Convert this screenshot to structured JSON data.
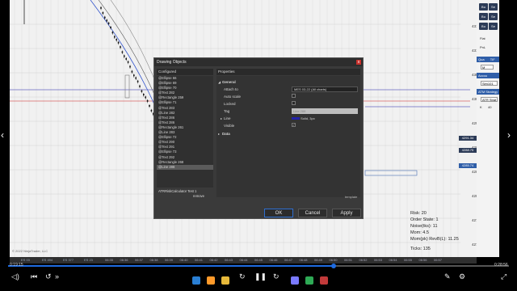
{
  "chart": {
    "price_labels": [
      "4315.00",
      "4310.00",
      "4305.00",
      "4300.00",
      "4295.00",
      "4290.00",
      "4285.00",
      "4280.00",
      "4275.00",
      "4270.00"
    ],
    "time_labels": [
      "06:35",
      "06:36",
      "06:37",
      "06:38",
      "06:39",
      "06:40",
      "06:41",
      "06:42",
      "06:43",
      "06:44",
      "06:45",
      "06:46",
      "06:47",
      "06:48",
      "06:49",
      "06:50",
      "06:51",
      "06:52",
      "06:53",
      "06:54",
      "06:55",
      "06:56",
      "06:57"
    ],
    "tags": [
      {
        "text": "4291.34",
        "color": "#2c3b57"
      },
      {
        "text": "4288.75",
        "color": "#2c3b57"
      },
      {
        "text": "4285.74",
        "color": "#2f5ea8"
      }
    ],
    "copyright": "© 2022 NinjaTrader, LLC"
  },
  "right_panel": {
    "buttons": [
      "Bu",
      "Se",
      "Bu",
      "Se",
      "Bu",
      "Se"
    ],
    "flat_label": "Flat",
    "pnl_label": "PnL",
    "qty_label": "Qua",
    "tif_label": "TIF",
    "qty_value": "1",
    "tif_value": "M",
    "acct_label": "Accou",
    "acct_value": "Sim101",
    "atm_label": "ATM Strategy",
    "atm_value": "ATR Strat",
    "status_lines": [
      "M",
      "R",
      "0",
      "K",
      "40"
    ]
  },
  "dialog": {
    "title": "Drawing Objects",
    "close": "x",
    "configured_header": "Configured",
    "properties_header": "Properties",
    "objects": [
      "@Ellipse 66",
      "@Ellipse 69",
      "@Ellipse 70",
      "@Text 282",
      "@Rectangle 259",
      "@Ellipse 71",
      "@Text 283",
      "@Line 282",
      "@Text 286",
      "@Text 286",
      "@Rectangle 261",
      "@Line 283",
      "@Ellipse 72",
      "@Text 290",
      "@Text 291",
      "@Ellipse 73",
      "@Text 292",
      "@Rectangle 268",
      "@Line 288"
    ],
    "indicator_item": "ATRRiskCalculator Test 1",
    "remove_label": "remove",
    "group_general": "General",
    "group_data": "Data",
    "props": {
      "attach_to_label": "Attach to",
      "attach_to_value": "MES 03-22 (All charts)",
      "auto_scale_label": "Auto scale",
      "locked_label": "Locked",
      "tag_label": "Tag",
      "tag_value": "Line 288",
      "line_label": "Line",
      "line_value": "Solid, 3px",
      "visible_label": "Visible",
      "visible_check": "✓"
    },
    "template_label": "template",
    "ok_label": "OK",
    "cancel_label": "Cancel",
    "apply_label": "Apply"
  },
  "info": {
    "risk": "Risk: 20",
    "order_state": "Order State: 1",
    "noise": "Noise(tks): 11",
    "mom": "Mom: 4.5",
    "mom_rev": "Mom(pk) RevB(L): 11.25",
    "ticks": "Ticks: 135"
  },
  "bottom_tabs": [
    "ES 03",
    "ES 494",
    "ES 377",
    "ES 23"
  ],
  "player": {
    "elapsed": "0:19:15",
    "remaining": "0:28:56",
    "progress": 0.65
  },
  "colors": {
    "candle": "#111111",
    "ma_blue": "#3355cc",
    "level_red": "#cc2222",
    "level_blue": "#2222aa"
  }
}
